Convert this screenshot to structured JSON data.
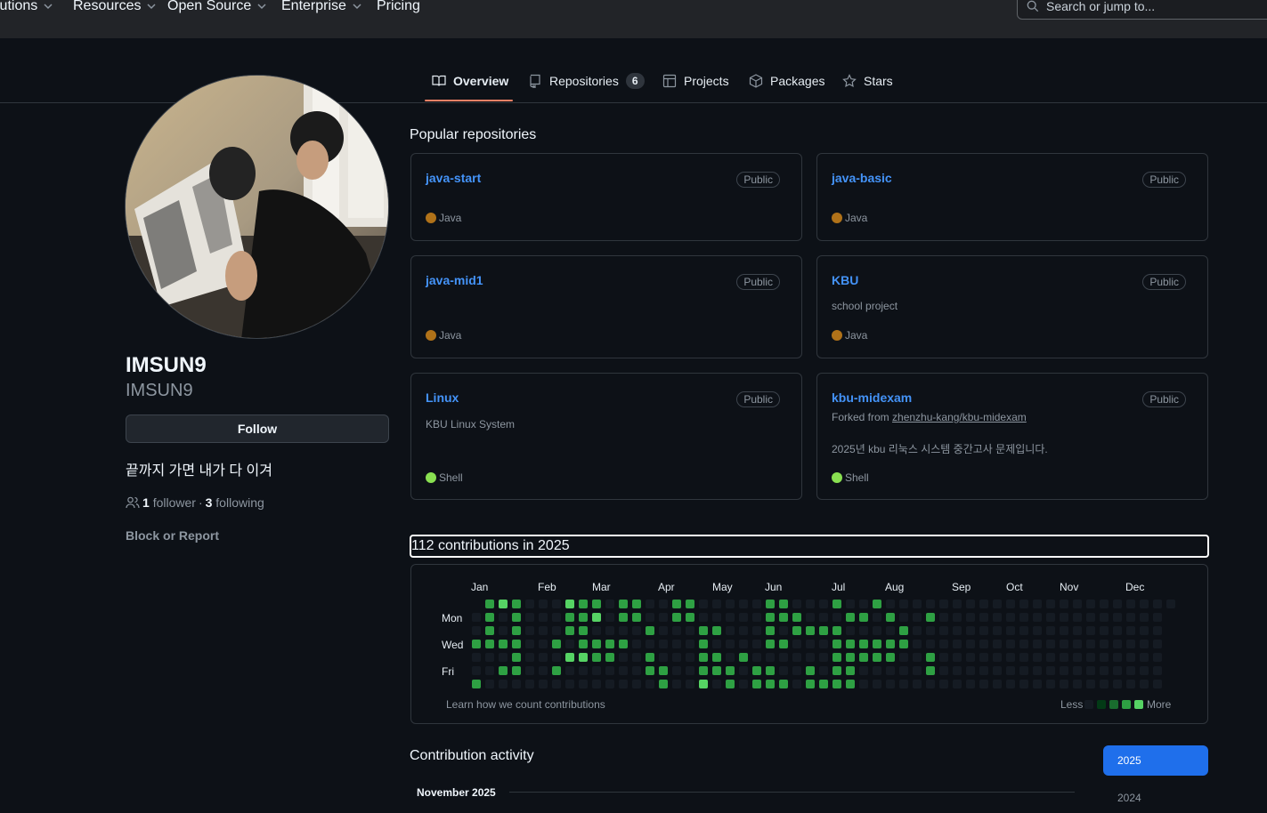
{
  "header": {
    "nav": [
      {
        "label": "lutions"
      },
      {
        "label": "Resources"
      },
      {
        "label": "Open Source"
      },
      {
        "label": "Enterprise"
      },
      {
        "label": "Pricing"
      }
    ],
    "search_placeholder": "Search or jump to..."
  },
  "tabs": {
    "overview": "Overview",
    "repositories": "Repositories",
    "repositories_count": "6",
    "projects": "Projects",
    "packages": "Packages",
    "stars": "Stars"
  },
  "profile": {
    "display_name": "IMSUN9",
    "login": "IMSUN9",
    "follow_label": "Follow",
    "bio": "끝까지 가면 내가 다 이겨",
    "followers_count": "1",
    "followers_label": "follower",
    "separator": "·",
    "following_count": "3",
    "following_label": "following",
    "block_label": "Block or Report"
  },
  "popular": {
    "title": "Popular repositories",
    "repos": [
      {
        "name": "java-start",
        "visibility": "Public",
        "description": "",
        "language": "Java",
        "language_color": "#b07219"
      },
      {
        "name": "java-basic",
        "visibility": "Public",
        "description": "",
        "language": "Java",
        "language_color": "#b07219"
      },
      {
        "name": "java-mid1",
        "visibility": "Public",
        "description": "",
        "language": "Java",
        "language_color": "#b07219"
      },
      {
        "name": "KBU",
        "visibility": "Public",
        "description": "school project",
        "language": "Java",
        "language_color": "#b07219"
      },
      {
        "name": "Linux",
        "visibility": "Public",
        "description": "KBU Linux System",
        "language": "Shell",
        "language_color": "#89e051"
      },
      {
        "name": "kbu-midexam",
        "visibility": "Public",
        "forked_prefix": "Forked from",
        "forked_from": "zhenzhu-kang/kbu-midexam",
        "description": "2025년 kbu 리눅스 시스템 중간고사 문제입니다.",
        "language": "Shell",
        "language_color": "#89e051"
      }
    ]
  },
  "contributions": {
    "title": "112 contributions in 2025",
    "months": [
      "Jan",
      "Feb",
      "Mar",
      "Apr",
      "May",
      "Jun",
      "Jul",
      "Aug",
      "Sep",
      "Oct",
      "Nov",
      "Dec"
    ],
    "days": [
      "Mon",
      "Wed",
      "Fri"
    ],
    "learn_label": "Learn how we count contributions",
    "less_label": "Less",
    "more_label": "More",
    "level_colors": [
      "#151b23",
      "#033a16",
      "#196c2e",
      "#2ea043",
      "#56d364"
    ]
  },
  "activity": {
    "title": "Contribution activity",
    "years": [
      "2025",
      "2024"
    ],
    "month_heading": "November 2025"
  }
}
